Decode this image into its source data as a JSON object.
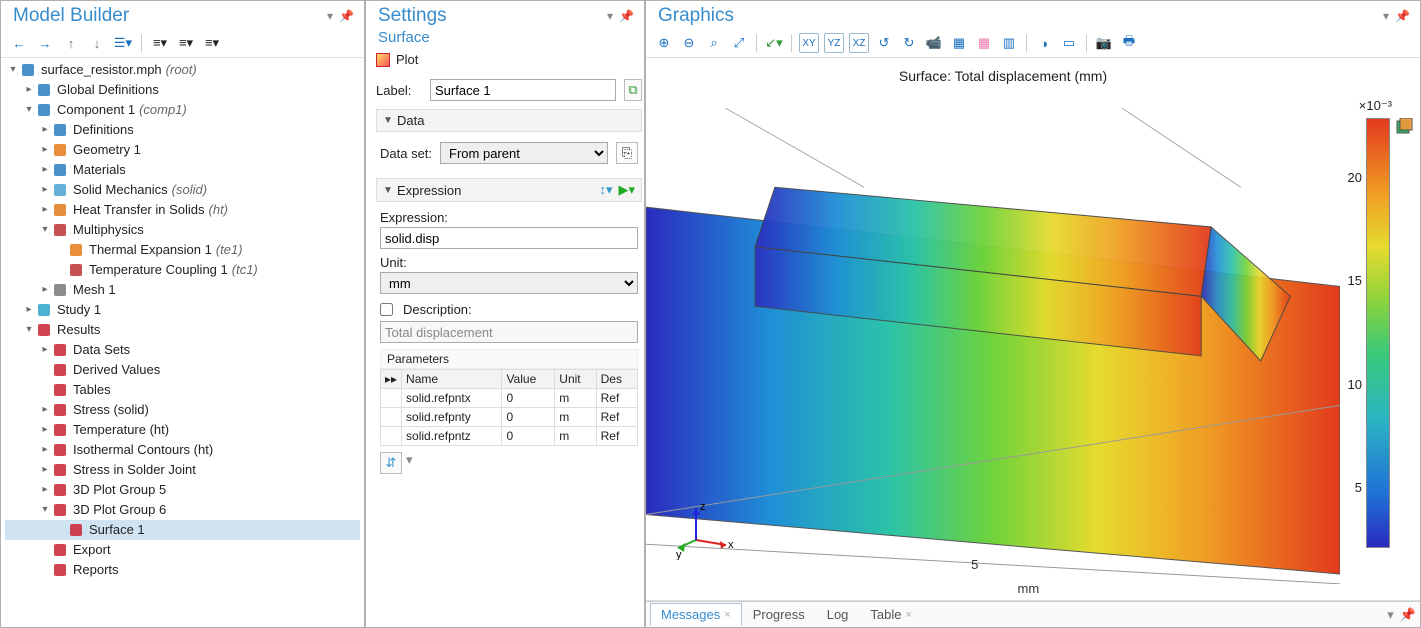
{
  "modelBuilder": {
    "title": "Model Builder",
    "tree": [
      {
        "indent": 0,
        "caret": "▾",
        "iconColor": "#2d7cc1",
        "label": "surface_resistor.mph",
        "suffix": "(root)"
      },
      {
        "indent": 1,
        "caret": "▸",
        "iconColor": "#2d7cc1",
        "label": "Global Definitions"
      },
      {
        "indent": 1,
        "caret": "▾",
        "iconColor": "#2d7cc1",
        "label": "Component 1",
        "suffix": "(comp1)"
      },
      {
        "indent": 2,
        "caret": "▸",
        "iconColor": "#2d7cc1",
        "label": "Definitions"
      },
      {
        "indent": 2,
        "caret": "▸",
        "iconColor": "#e77a1a",
        "label": "Geometry 1"
      },
      {
        "indent": 2,
        "caret": "▸",
        "iconColor": "#2d7cc1",
        "label": "Materials"
      },
      {
        "indent": 2,
        "caret": "▸",
        "iconColor": "#4aa3d1",
        "label": "Solid Mechanics",
        "suffix": "(solid)"
      },
      {
        "indent": 2,
        "caret": "▸",
        "iconColor": "#e07a1a",
        "label": "Heat Transfer in Solids",
        "suffix": "(ht)"
      },
      {
        "indent": 2,
        "caret": "▾",
        "iconColor": "#b33",
        "label": "Multiphysics"
      },
      {
        "indent": 3,
        "caret": " ",
        "iconColor": "#e77a1a",
        "label": "Thermal Expansion 1",
        "suffix": "(te1)"
      },
      {
        "indent": 3,
        "caret": " ",
        "iconColor": "#b33",
        "label": "Temperature Coupling 1",
        "suffix": "(tc1)"
      },
      {
        "indent": 2,
        "caret": "▸",
        "iconColor": "#777",
        "label": "Mesh 1"
      },
      {
        "indent": 1,
        "caret": "▸",
        "iconColor": "#2aa6c9",
        "label": "Study 1"
      },
      {
        "indent": 1,
        "caret": "▾",
        "iconColor": "#c23",
        "label": "Results"
      },
      {
        "indent": 2,
        "caret": "▸",
        "iconColor": "#c23",
        "label": "Data Sets"
      },
      {
        "indent": 2,
        "caret": " ",
        "iconColor": "#c23",
        "label": "Derived Values"
      },
      {
        "indent": 2,
        "caret": " ",
        "iconColor": "#c23",
        "label": "Tables"
      },
      {
        "indent": 2,
        "caret": "▸",
        "iconColor": "#c23",
        "label": "Stress (solid)"
      },
      {
        "indent": 2,
        "caret": "▸",
        "iconColor": "#c23",
        "label": "Temperature (ht)"
      },
      {
        "indent": 2,
        "caret": "▸",
        "iconColor": "#c23",
        "label": "Isothermal Contours (ht)"
      },
      {
        "indent": 2,
        "caret": "▸",
        "iconColor": "#c23",
        "label": "Stress in Solder Joint"
      },
      {
        "indent": 2,
        "caret": "▸",
        "iconColor": "#c23",
        "label": "3D Plot Group 5"
      },
      {
        "indent": 2,
        "caret": "▾",
        "iconColor": "#c23",
        "label": "3D Plot Group 6"
      },
      {
        "indent": 3,
        "caret": " ",
        "iconColor": "#c23",
        "label": "Surface 1",
        "selected": true
      },
      {
        "indent": 2,
        "caret": " ",
        "iconColor": "#c23",
        "label": "Export"
      },
      {
        "indent": 2,
        "caret": " ",
        "iconColor": "#c23",
        "label": "Reports"
      }
    ]
  },
  "settings": {
    "title": "Settings",
    "subtitle": "Surface",
    "plotBtn": "Plot",
    "labelField": {
      "label": "Label:",
      "value": "Surface 1"
    },
    "dataSection": {
      "title": "Data",
      "dataset_label": "Data set:",
      "dataset_value": "From parent"
    },
    "exprSection": {
      "title": "Expression",
      "expression_label": "Expression:",
      "expression_value": "solid.disp",
      "unit_label": "Unit:",
      "unit_value": "mm",
      "desc_checkbox": "Description:",
      "desc_value": "Total displacement",
      "params_title": "Parameters",
      "columns": [
        "Name",
        "Value",
        "Unit",
        "Des"
      ],
      "rows": [
        {
          "name": "solid.refpntx",
          "value": "0",
          "unit": "m",
          "des": "Ref"
        },
        {
          "name": "solid.refpnty",
          "value": "0",
          "unit": "m",
          "des": "Ref"
        },
        {
          "name": "solid.refpntz",
          "value": "0",
          "unit": "m",
          "des": "Ref"
        }
      ]
    }
  },
  "graphics": {
    "title": "Graphics",
    "plotTitle": "Surface: Total displacement (mm)",
    "colorbar": {
      "exp": "×10⁻³",
      "ticks": [
        {
          "v": "20",
          "pct": 14
        },
        {
          "v": "15",
          "pct": 38
        },
        {
          "v": "10",
          "pct": 62
        },
        {
          "v": "5",
          "pct": 86
        }
      ]
    },
    "xAxisLabel": "mm",
    "xTick": "5",
    "triad": {
      "x": "x",
      "y": "y",
      "z": "z"
    },
    "tabs": [
      {
        "label": "Messages",
        "active": true,
        "closable": true
      },
      {
        "label": "Progress",
        "active": false,
        "closable": false
      },
      {
        "label": "Log",
        "active": false,
        "closable": false
      },
      {
        "label": "Table",
        "active": false,
        "closable": true
      }
    ]
  }
}
